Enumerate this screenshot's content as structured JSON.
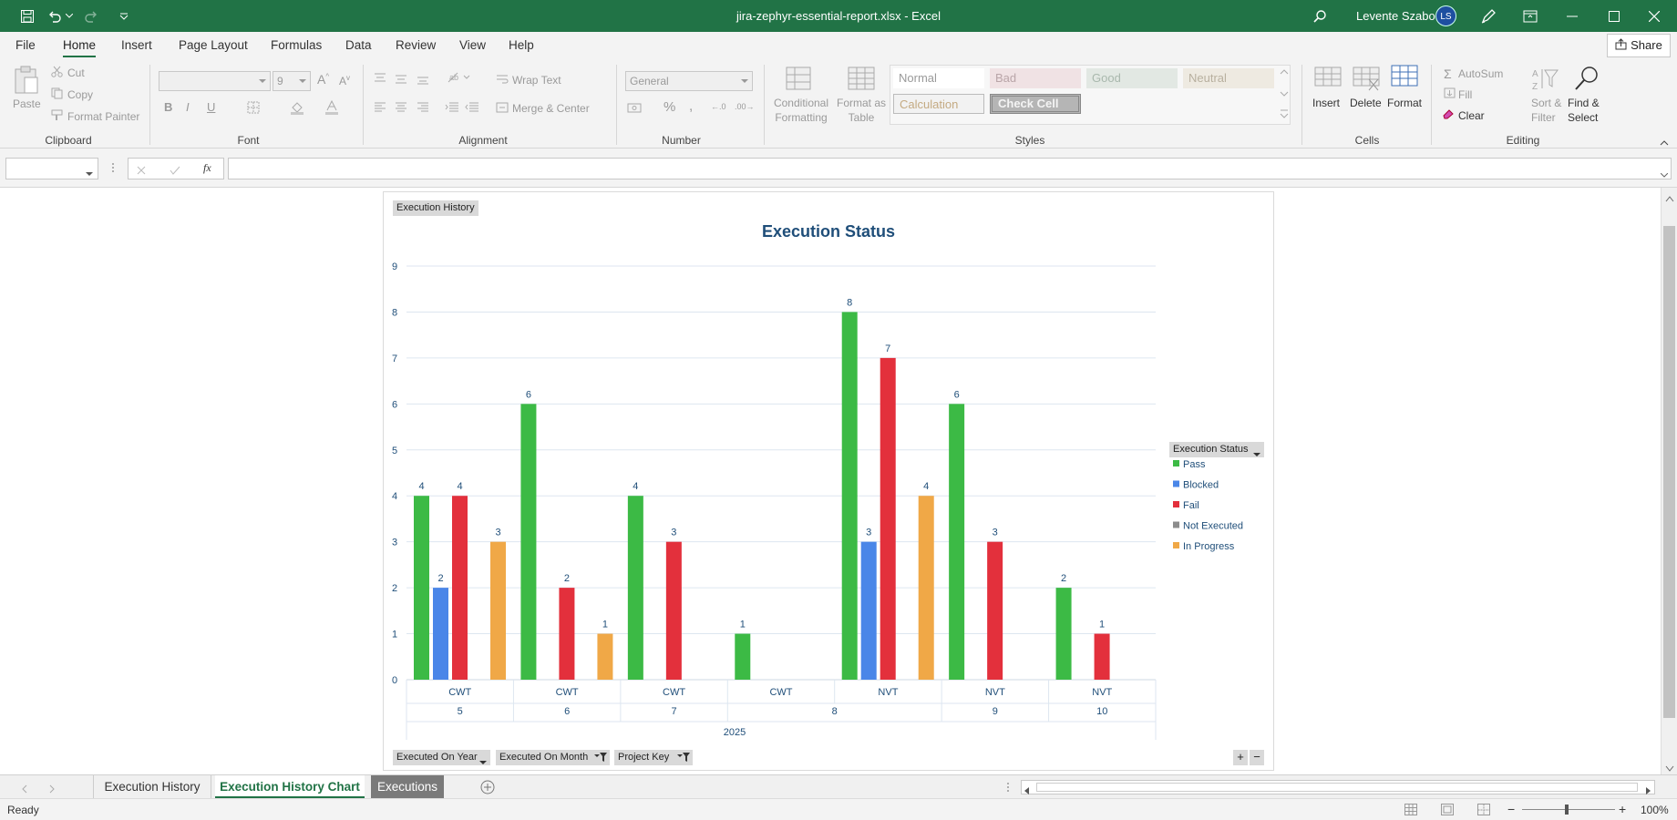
{
  "window": {
    "title": "jira-zephyr-essential-report.xlsx  -  Excel",
    "user_name": "Levente Szabo",
    "user_initials": "LS"
  },
  "menu": {
    "items": [
      "File",
      "Home",
      "Insert",
      "Page Layout",
      "Formulas",
      "Data",
      "Review",
      "View",
      "Help"
    ],
    "active": "Home",
    "share_label": "Share"
  },
  "ribbon": {
    "clipboard": {
      "label": "Clipboard",
      "paste": "Paste",
      "cut": "Cut",
      "copy": "Copy",
      "format_painter": "Format Painter"
    },
    "font": {
      "label": "Font",
      "size": "9"
    },
    "alignment": {
      "label": "Alignment",
      "wrap_text": "Wrap Text",
      "merge_center": "Merge & Center"
    },
    "number": {
      "label": "Number",
      "format": "General"
    },
    "styles": {
      "label": "Styles",
      "conditional_formatting_1": "Conditional",
      "conditional_formatting_2": "Formatting",
      "format_as_table_1": "Format as",
      "format_as_table_2": "Table",
      "normal": "Normal",
      "bad": "Bad",
      "good": "Good",
      "neutral": "Neutral",
      "calculation": "Calculation",
      "check_cell": "Check Cell"
    },
    "cells": {
      "label": "Cells",
      "insert": "Insert",
      "delete": "Delete",
      "format": "Format"
    },
    "editing": {
      "label": "Editing",
      "autosum": "AutoSum",
      "fill": "Fill",
      "clear": "Clear",
      "sort_filter_1": "Sort &",
      "sort_filter_2": "Filter",
      "find_select_1": "Find &",
      "find_select_2": "Select"
    }
  },
  "formula_bar": {
    "name_box": "",
    "formula": "",
    "fx": "fx"
  },
  "pivot": {
    "top_field": "Execution History",
    "bottom_fields": [
      "Executed On Year",
      "Executed On Month",
      "Project Key"
    ],
    "legend_field": "Execution Status"
  },
  "chart_data": {
    "type": "bar",
    "title": "Execution Status",
    "ylim": [
      0,
      9
    ],
    "yticks": [
      0,
      1,
      2,
      3,
      4,
      5,
      6,
      7,
      8,
      9
    ],
    "categories": [
      {
        "project": "CWT",
        "month": "5"
      },
      {
        "project": "CWT",
        "month": "6"
      },
      {
        "project": "CWT",
        "month": "7"
      },
      {
        "project": "CWT",
        "month": "8"
      },
      {
        "project": "NVT",
        "month": "8"
      },
      {
        "project": "NVT",
        "month": "9"
      },
      {
        "project": "NVT",
        "month": "10"
      }
    ],
    "year": "2025",
    "series": [
      {
        "name": "Pass",
        "color": "#3cba45",
        "values": [
          4,
          6,
          4,
          1,
          8,
          6,
          2
        ]
      },
      {
        "name": "Blocked",
        "color": "#4a86e8",
        "values": [
          2,
          null,
          null,
          null,
          3,
          null,
          null
        ]
      },
      {
        "name": "Fail",
        "color": "#e3303c",
        "values": [
          4,
          2,
          3,
          null,
          7,
          3,
          1
        ]
      },
      {
        "name": "Not Executed",
        "color": "#8c8c8c",
        "values": [
          null,
          null,
          null,
          null,
          null,
          null,
          null
        ]
      },
      {
        "name": "In Progress",
        "color": "#f0a847",
        "values": [
          3,
          1,
          null,
          null,
          4,
          null,
          null
        ]
      }
    ],
    "legend_position": "right",
    "grid": true
  },
  "sheet_tabs": {
    "tabs": [
      "Execution History",
      "Execution History Chart",
      "Executions"
    ],
    "active": "Execution History Chart"
  },
  "status": {
    "text": "Ready",
    "zoom": "100%"
  }
}
